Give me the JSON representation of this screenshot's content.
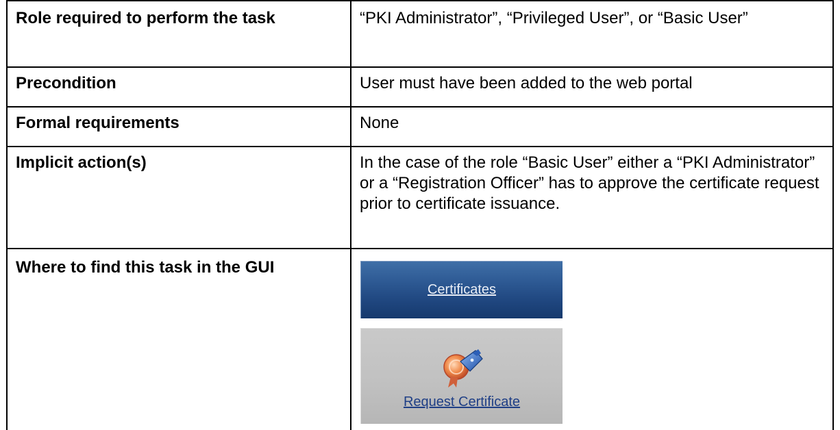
{
  "rows": [
    {
      "label": "Role required to perform the task",
      "value": "“PKI Administrator”, “Privileged User”, or “Basic User”"
    },
    {
      "label": "Precondition",
      "value": "User must have been added to the web portal"
    },
    {
      "label": "Formal requirements",
      "value": "None"
    },
    {
      "label": "Implicit action(s)",
      "value": "In the case of the role “Basic User” either a “PKI Administrator” or a “Registration Officer” has to approve the certificate request prior to certificate issuance."
    },
    {
      "label": "Where to find this task in the GUI"
    }
  ],
  "gui": {
    "certificates_label": "Certificates",
    "request_certificate_label": "Request Certificate",
    "request_icon": "certificate-request-icon",
    "certificates_color": "#2e5a94",
    "request_bg_color": "#c1c1c1"
  }
}
